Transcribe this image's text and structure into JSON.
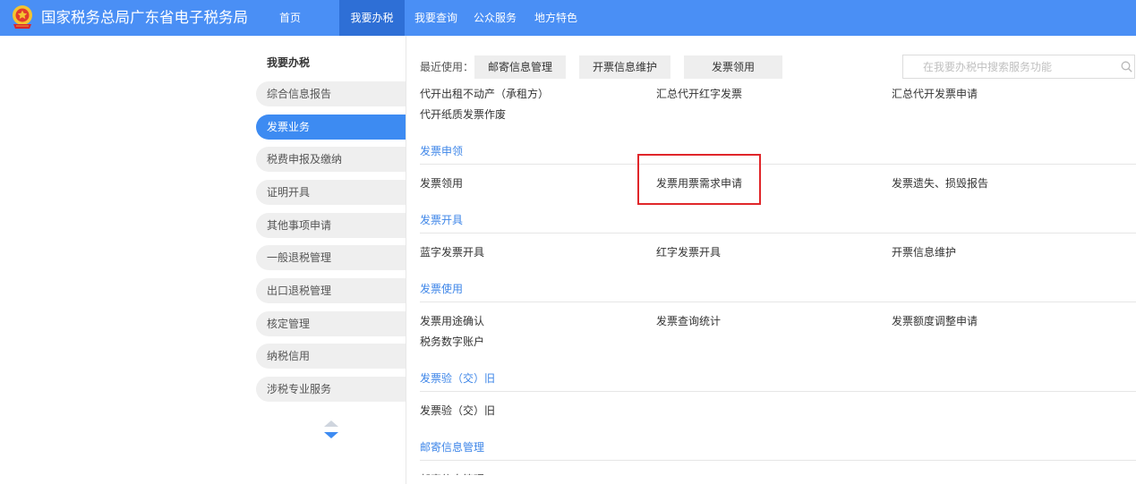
{
  "header": {
    "logo_icon": "tax-emblem-icon",
    "title": "国家税务总局广东省电子税务局",
    "nav": [
      {
        "label": "首页",
        "active": false
      },
      {
        "label": "我要办税",
        "active": true
      },
      {
        "label": "我要查询",
        "active": false
      },
      {
        "label": "公众服务",
        "active": false
      },
      {
        "label": "地方特色",
        "active": false
      }
    ]
  },
  "sidebar": {
    "title": "我要办税",
    "items": [
      {
        "label": "综合信息报告",
        "active": false
      },
      {
        "label": "发票业务",
        "active": true
      },
      {
        "label": "税费申报及缴纳",
        "active": false
      },
      {
        "label": "证明开具",
        "active": false
      },
      {
        "label": "其他事项申请",
        "active": false
      },
      {
        "label": "一般退税管理",
        "active": false
      },
      {
        "label": "出口退税管理",
        "active": false
      },
      {
        "label": "核定管理",
        "active": false
      },
      {
        "label": "纳税信用",
        "active": false
      },
      {
        "label": "涉税专业服务",
        "active": false
      }
    ],
    "scroll_icons": [
      "arrow-up-icon",
      "arrow-down-icon"
    ]
  },
  "recent": {
    "label": "最近使用：",
    "items": [
      "邮寄信息管理",
      "开票信息维护",
      "发票领用"
    ]
  },
  "search": {
    "placeholder": "在我要办税中搜索服务功能",
    "icon": "search-icon"
  },
  "sections": [
    {
      "items": [
        "代开出租不动产（承租方）",
        "汇总代开红字发票",
        "汇总代开发票申请",
        "代开纸质发票作废"
      ]
    },
    {
      "title": "发票申领",
      "items": [
        "发票领用",
        "发票用票需求申请",
        "发票遗失、损毁报告"
      ]
    },
    {
      "title": "发票开具",
      "items": [
        "蓝字发票开具",
        "红字发票开具",
        "开票信息维护"
      ]
    },
    {
      "title": "发票使用",
      "items": [
        "发票用途确认",
        "发票查询统计",
        "发票额度调整申请",
        "税务数字账户"
      ]
    },
    {
      "title": "发票验（交）旧",
      "items": [
        "发票验（交）旧"
      ]
    },
    {
      "title": "邮寄信息管理",
      "items": [
        "邮寄信息管理"
      ]
    }
  ],
  "colors": {
    "brand": "#4a8ff5",
    "active-tab": "#2e6fd6",
    "sidebar-active": "#3d8bf2",
    "section-title": "#3e86e8",
    "highlight": "#e0262a"
  }
}
